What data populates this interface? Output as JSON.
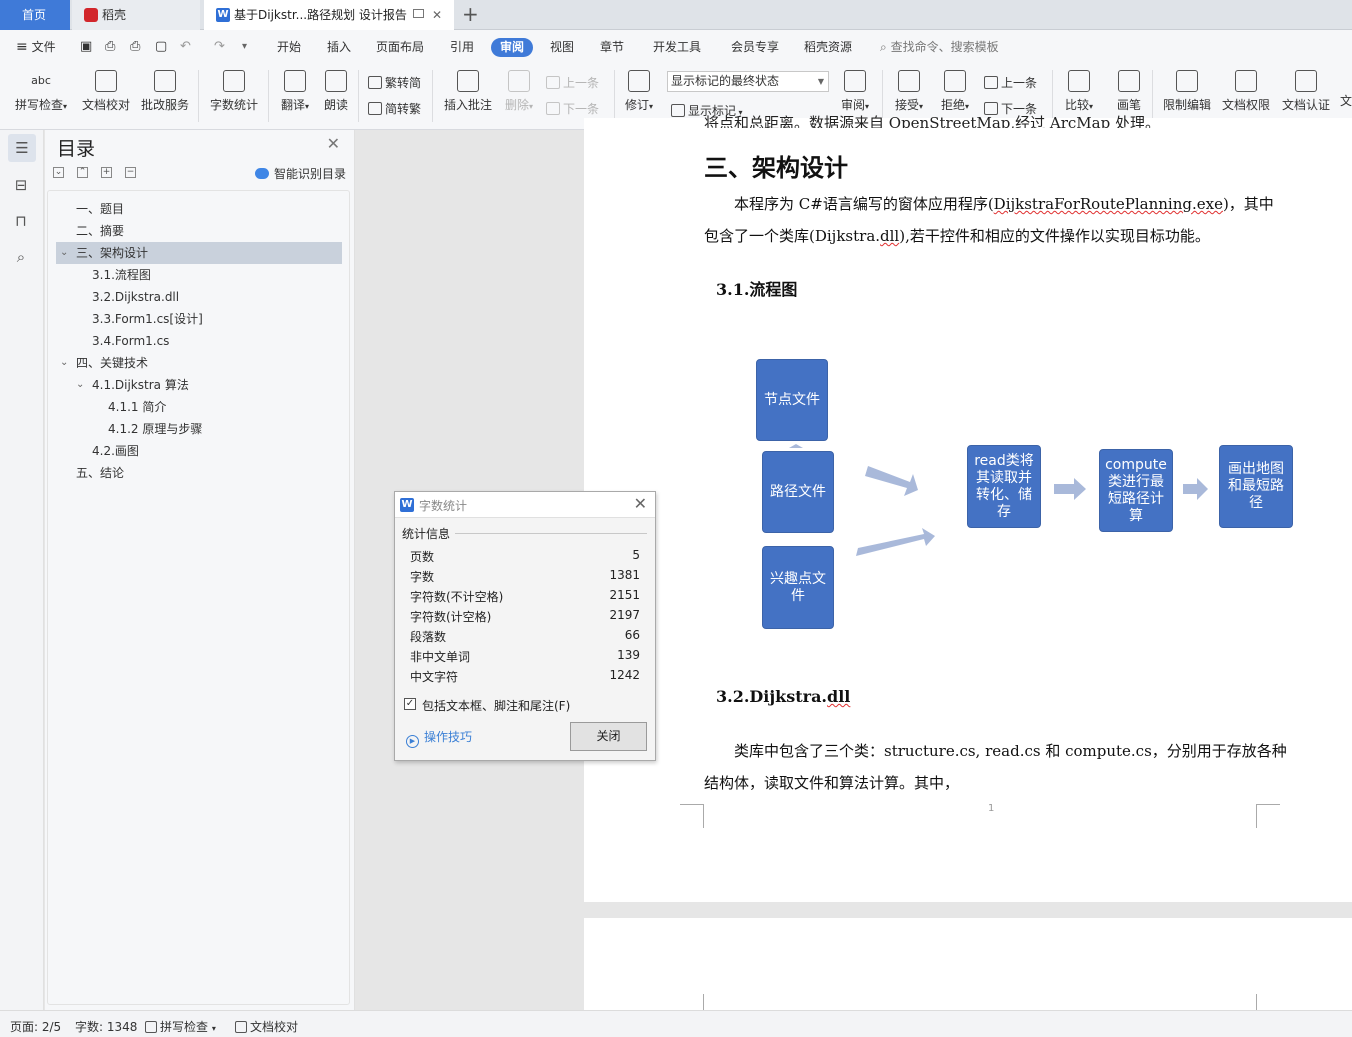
{
  "tabs": {
    "home": "首页",
    "daoke": "稻壳",
    "doc": "基于Dijkstr...路径规划 设计报告"
  },
  "menu": {
    "file": "文件",
    "items": [
      "开始",
      "插入",
      "页面布局",
      "引用",
      "审阅",
      "视图",
      "章节",
      "开发工具",
      "会员专享",
      "稻壳资源"
    ],
    "active": "审阅",
    "search_placeholder": "查找命令、搜索模板"
  },
  "ribbon": {
    "spell_check": "拼写检查",
    "doc_proof": "文档校对",
    "batch_edit": "批改服务",
    "word_count": "字数统计",
    "translate": "翻译",
    "read_aloud": "朗读",
    "trad_to_simp": "繁转简",
    "simp_to_trad": "简转繁",
    "insert_comment": "插入批注",
    "delete": "删除",
    "prev": "上一条",
    "next": "下一条",
    "revise": "修订",
    "markup_state": "显示标记的最终状态",
    "show_markup": "显示标记",
    "review": "审阅",
    "accept": "接受",
    "reject": "拒绝",
    "prev2": "上一条",
    "next2": "下一条",
    "compare": "比较",
    "ink": "画笔",
    "restrict": "限制编辑",
    "permission": "文档权限",
    "certify": "文档认证",
    "cut_text": "文"
  },
  "toc": {
    "title": "目录",
    "smart_label": "智能识别目录",
    "items": [
      "一、题目",
      "二、摘要",
      "三、架构设计",
      "3.1.流程图",
      "3.2.Dijkstra.dll",
      "3.3.Form1.cs[设计]",
      "3.4.Form1.cs",
      "四、关键技术",
      "4.1.Dijkstra 算法",
      "4.1.1 简介",
      "4.1.2 原理与步骤",
      "4.2.画图",
      "五、结论"
    ]
  },
  "document": {
    "top_cut": "将点和总距离。数据源来自 OpenStreetMap,经过 ArcMap 处理。",
    "heading": "三、架构设计",
    "para1_a": "本程序为 C#语言编写的窗体应用程序(",
    "para1_b": "DijkstraForRoutePlanning.exe",
    "para1_c": ")，其中",
    "para2_a": "包含了一个类库(Dijkstra.",
    "para2_b": "dll",
    "para2_c": "),若干控件和相应的文件操作以实现目标功能。",
    "h_flow": "3.1.流程图",
    "flow": {
      "node_file": "节点文件",
      "path_file": "路径文件",
      "poi_file": "兴趣点文件",
      "read": "read类将其读取并转化、储存",
      "compute": "compute类进行最短路径计算",
      "draw": "画出地图和最短路径"
    },
    "h_dll_a": "3.2.Dijkstra.",
    "h_dll_b": "dll",
    "para3": "类库中包含了三个类：structure.cs, read.cs 和 compute.cs，分别用于存放各种",
    "para4": "结构体，读取文件和算法计算。其中，",
    "page_num": "1"
  },
  "dialog": {
    "title": "字数统计",
    "section": "统计信息",
    "rows": [
      {
        "label": "页数",
        "value": "5"
      },
      {
        "label": "字数",
        "value": "1381"
      },
      {
        "label": "字符数(不计空格)",
        "value": "2151"
      },
      {
        "label": "字符数(计空格)",
        "value": "2197"
      },
      {
        "label": "段落数",
        "value": "66"
      },
      {
        "label": "非中文单词",
        "value": "139"
      },
      {
        "label": "中文字符",
        "value": "1242"
      }
    ],
    "include_label": "包括文本框、脚注和尾注(F)",
    "include_checked": true,
    "tips": "操作技巧",
    "close": "关闭"
  },
  "status": {
    "page": "页面: 2/5",
    "words": "字数: 1348",
    "spell": "拼写检查",
    "proof": "文档校对"
  },
  "colors": {
    "accent": "#3f7ad8",
    "flow_box": "#4472c4",
    "arrow": "#a9b9da"
  }
}
